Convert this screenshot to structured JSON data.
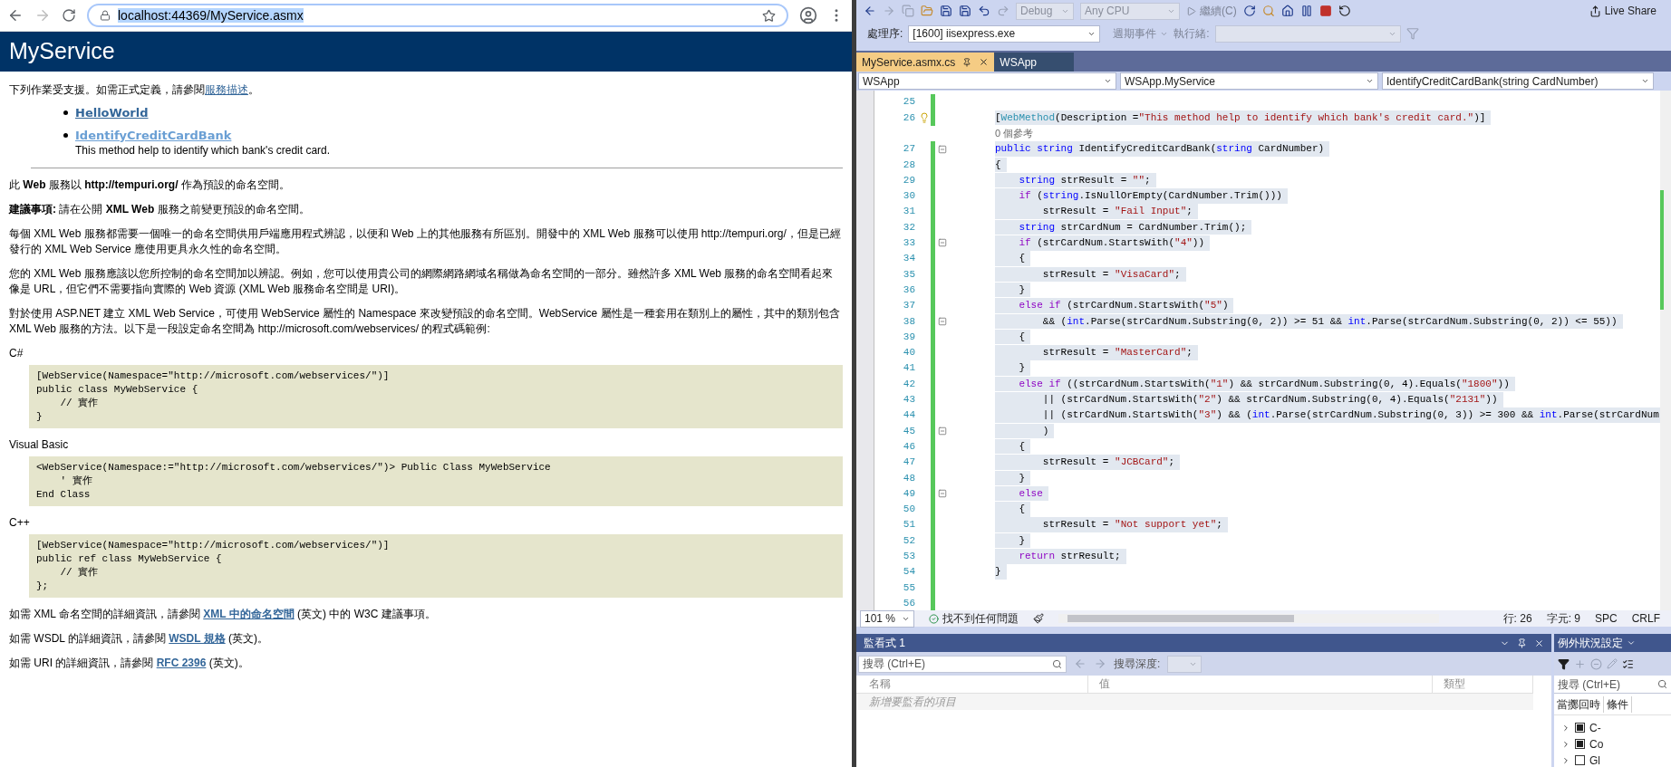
{
  "browser": {
    "url": "localhost:44369/MyService.asmx",
    "url_selected": true
  },
  "page": {
    "title": "MyService",
    "intro": {
      "before": "下列作業受支援。如需正式定義，請參閱",
      "link": "服務描述",
      "after": "。"
    },
    "operations": [
      {
        "name": "HelloWorld",
        "visited": false
      },
      {
        "name": "IdentifyCreditCardBank",
        "visited": true,
        "description": "This method help to identify which bank's credit card."
      }
    ],
    "notices": [
      "此 **Web** 服務以 **http://tempuri.org/** 作為預設的命名空間。",
      "**建議事項:** 請在公開 **XML Web** 服務之前變更預設的命名空間。"
    ],
    "paragraphs": [
      "每個 XML Web 服務都需要一個唯一的命名空間供用戶端應用程式辨認，以便和 Web 上的其他服務有所區別。開發中的 XML Web 服務可以使用 http://tempuri.org/，但是已經發行的 XML Web Service 應使用更具永久性的命名空間。",
      "您的 XML Web 服務應該以您所控制的命名空間加以辨認。例如，您可以使用貴公司的網際網路網域名稱做為命名空間的一部分。雖然許多 XML Web 服務的命名空間看起來像是 URL，但它們不需要指向實際的 Web 資源 (XML Web 服務命名空間是 URI)。",
      "對於使用 ASP.NET 建立 XML Web Service，可使用 WebService 屬性的 Namespace 來改變預設的命名空間。WebService 屬性是一種套用在類別上的屬性，其中的類別包含 XML Web 服務的方法。以下是一段設定命名空間為 http://microsoft.com/webservices/ 的程式碼範例:"
    ],
    "samples": [
      {
        "language": "C#",
        "code": "[WebService(Namespace=\"http://microsoft.com/webservices/\")]\npublic class MyWebService {\n    // 實作\n}"
      },
      {
        "language": "Visual Basic",
        "code": "<WebService(Namespace:=\"http://microsoft.com/webservices/\")> Public Class MyWebService\n    ' 實作\nEnd Class"
      },
      {
        "language": "C++",
        "code": "[WebService(Namespace=\"http://microsoft.com/webservices/\")]\npublic ref class MyWebService {\n    // 實作\n};"
      }
    ],
    "references": [
      {
        "before": "如需 XML 命名空間的詳細資訊，請參閱 ",
        "link": "XML 中的命名空間",
        "after": " (英文) 中的 W3C 建議事項。"
      },
      {
        "before": "如需 WSDL 的詳細資訊，請參閱 ",
        "link": "WSDL 規格",
        "after": " (英文)。"
      },
      {
        "before": "如需 URI 的詳細資訊，請參閱 ",
        "link": "RFC 2396",
        "after": " (英文)。"
      }
    ]
  },
  "vs": {
    "toolbar": {
      "configuration": {
        "label": "Debug",
        "disabled": true
      },
      "platform": {
        "label": "Any CPU",
        "disabled": true
      },
      "continue": "繼續(C)",
      "live_share": "Live Share"
    },
    "toolbar2": {
      "process_label": "處理序:",
      "process": "[1600] iisexpress.exe",
      "lifecycle": "週期事件",
      "thread_label": "執行緒:"
    },
    "tabs": [
      {
        "label": "MyService.asmx.cs",
        "selected": true
      },
      {
        "label": "WSApp",
        "selected": false
      }
    ],
    "nav": [
      "WSApp",
      "WSApp.MyService",
      "IdentifyCreditCardBank(string CardNumber)"
    ],
    "code": {
      "lines": [
        {
          "num": "25"
        },
        {
          "num": "26",
          "selected": true,
          "bulb": true,
          "tokens": [
            {
              "kind": "plain",
              "text": "["
            },
            {
              "kind": "type",
              "text": "WebMethod"
            },
            {
              "kind": "plain",
              "text": "(Description ="
            },
            {
              "kind": "string",
              "text": "\"This method help to identify which bank's credit card.\""
            },
            {
              "kind": "plain",
              "text": ")]"
            }
          ]
        },
        {
          "kind": "hint",
          "tokens": [
            {
              "kind": "hint",
              "text": "0 個參考"
            }
          ]
        },
        {
          "num": "27",
          "selected": true,
          "fold": true,
          "tokens": [
            {
              "kind": "keyword",
              "text": "public string"
            },
            {
              "kind": "plain",
              "text": " IdentifyCreditCardBank("
            },
            {
              "kind": "keyword",
              "text": "string"
            },
            {
              "kind": "plain",
              "text": " CardNumber)"
            }
          ]
        },
        {
          "num": "28",
          "selected": true,
          "tokens": [
            {
              "kind": "plain",
              "text": "{"
            }
          ]
        },
        {
          "num": "29",
          "selected": true,
          "tokens": [
            {
              "kind": "keyword",
              "text": "    string"
            },
            {
              "kind": "plain",
              "text": " strResult = "
            },
            {
              "kind": "string",
              "text": "\"\""
            },
            {
              "kind": "plain",
              "text": ";"
            }
          ]
        },
        {
          "num": "30",
          "selected": true,
          "tokens": [
            {
              "kind": "control",
              "text": "    if"
            },
            {
              "kind": "plain",
              "text": " ("
            },
            {
              "kind": "keyword",
              "text": "string"
            },
            {
              "kind": "plain",
              "text": ".IsNullOrEmpty(CardNumber.Trim()))"
            }
          ]
        },
        {
          "num": "31",
          "selected": true,
          "tokens": [
            {
              "kind": "plain",
              "text": "        strResult = "
            },
            {
              "kind": "string",
              "text": "\"Fail Input\""
            },
            {
              "kind": "plain",
              "text": ";"
            }
          ]
        },
        {
          "num": "32",
          "selected": true,
          "tokens": [
            {
              "kind": "keyword",
              "text": "    string"
            },
            {
              "kind": "plain",
              "text": " strCardNum = CardNumber.Trim();"
            }
          ]
        },
        {
          "num": "33",
          "selected": true,
          "fold": true,
          "tokens": [
            {
              "kind": "control",
              "text": "    if"
            },
            {
              "kind": "plain",
              "text": " (strCardNum.StartsWith("
            },
            {
              "kind": "string",
              "text": "\"4\""
            },
            {
              "kind": "plain",
              "text": "))"
            }
          ]
        },
        {
          "num": "34",
          "selected": true,
          "tokens": [
            {
              "kind": "plain",
              "text": "    {"
            }
          ]
        },
        {
          "num": "35",
          "selected": true,
          "tokens": [
            {
              "kind": "plain",
              "text": "        strResult = "
            },
            {
              "kind": "string",
              "text": "\"VisaCard\""
            },
            {
              "kind": "plain",
              "text": ";"
            }
          ]
        },
        {
          "num": "36",
          "selected": true,
          "tokens": [
            {
              "kind": "plain",
              "text": "    }"
            }
          ]
        },
        {
          "num": "37",
          "selected": true,
          "tokens": [
            {
              "kind": "control",
              "text": "    else if"
            },
            {
              "kind": "plain",
              "text": " (strCardNum.StartsWith("
            },
            {
              "kind": "string",
              "text": "\"5\""
            },
            {
              "kind": "plain",
              "text": ")"
            }
          ]
        },
        {
          "num": "38",
          "selected": true,
          "fold": true,
          "tokens": [
            {
              "kind": "plain",
              "text": "        && ("
            },
            {
              "kind": "keyword",
              "text": "int"
            },
            {
              "kind": "plain",
              "text": ".Parse(strCardNum.Substring(0, 2)) >= 51 && "
            },
            {
              "kind": "keyword",
              "text": "int"
            },
            {
              "kind": "plain",
              "text": ".Parse(strCardNum.Substring(0, 2)) <= 55))"
            }
          ]
        },
        {
          "num": "39",
          "selected": true,
          "tokens": [
            {
              "kind": "plain",
              "text": "    {"
            }
          ]
        },
        {
          "num": "40",
          "selected": true,
          "tokens": [
            {
              "kind": "plain",
              "text": "        strResult = "
            },
            {
              "kind": "string",
              "text": "\"MasterCard\""
            },
            {
              "kind": "plain",
              "text": ";"
            }
          ]
        },
        {
          "num": "41",
          "selected": true,
          "tokens": [
            {
              "kind": "plain",
              "text": "    }"
            }
          ]
        },
        {
          "num": "42",
          "selected": true,
          "tokens": [
            {
              "kind": "control",
              "text": "    else if"
            },
            {
              "kind": "plain",
              "text": " ((strCardNum.StartsWith("
            },
            {
              "kind": "string",
              "text": "\"1\""
            },
            {
              "kind": "plain",
              "text": ") && strCardNum.Substring(0, 4).Equals("
            },
            {
              "kind": "string",
              "text": "\"1800\""
            },
            {
              "kind": "plain",
              "text": "))"
            }
          ]
        },
        {
          "num": "43",
          "selected": true,
          "tokens": [
            {
              "kind": "plain",
              "text": "        || (strCardNum.StartsWith("
            },
            {
              "kind": "string",
              "text": "\"2\""
            },
            {
              "kind": "plain",
              "text": ") && strCardNum.Substring(0, 4).Equals("
            },
            {
              "kind": "string",
              "text": "\"2131\""
            },
            {
              "kind": "plain",
              "text": "))"
            }
          ]
        },
        {
          "num": "44",
          "selected": true,
          "tokens": [
            {
              "kind": "plain",
              "text": "        || (strCardNum.StartsWith("
            },
            {
              "kind": "string",
              "text": "\"3\""
            },
            {
              "kind": "plain",
              "text": ") && ("
            },
            {
              "kind": "keyword",
              "text": "int"
            },
            {
              "kind": "plain",
              "text": ".Parse(strCardNum.Substring(0, 3)) >= 300 && "
            },
            {
              "kind": "keyword",
              "text": "int"
            },
            {
              "kind": "plain",
              "text": ".Parse(strCardNum"
            }
          ]
        },
        {
          "num": "45",
          "selected": true,
          "fold": true,
          "tokens": [
            {
              "kind": "plain",
              "text": "        )"
            }
          ]
        },
        {
          "num": "46",
          "selected": true,
          "tokens": [
            {
              "kind": "plain",
              "text": "    {"
            }
          ]
        },
        {
          "num": "47",
          "selected": true,
          "tokens": [
            {
              "kind": "plain",
              "text": "        strResult = "
            },
            {
              "kind": "string",
              "text": "\"JCBCard\""
            },
            {
              "kind": "plain",
              "text": ";"
            }
          ]
        },
        {
          "num": "48",
          "selected": true,
          "tokens": [
            {
              "kind": "plain",
              "text": "    }"
            }
          ]
        },
        {
          "num": "49",
          "selected": true,
          "fold": true,
          "tokens": [
            {
              "kind": "control",
              "text": "    else"
            }
          ]
        },
        {
          "num": "50",
          "selected": true,
          "tokens": [
            {
              "kind": "plain",
              "text": "    {"
            }
          ]
        },
        {
          "num": "51",
          "selected": true,
          "tokens": [
            {
              "kind": "plain",
              "text": "        strResult = "
            },
            {
              "kind": "string",
              "text": "\"Not support yet\""
            },
            {
              "kind": "plain",
              "text": ";"
            }
          ]
        },
        {
          "num": "52",
          "selected": true,
          "tokens": [
            {
              "kind": "plain",
              "text": "    }"
            }
          ]
        },
        {
          "num": "53",
          "selected": true,
          "tokens": [
            {
              "kind": "control",
              "text": "    return"
            },
            {
              "kind": "plain",
              "text": " strResult;"
            }
          ]
        },
        {
          "num": "54",
          "selected": true,
          "tokens": [
            {
              "kind": "plain",
              "text": "}"
            }
          ]
        },
        {
          "num": "55"
        },
        {
          "num": "56"
        }
      ]
    },
    "status": {
      "zoom": "101 %",
      "issues": "找不到任何問題",
      "line": "行: 26",
      "column": "字元: 9",
      "spacing": "SPC",
      "line_ending": "CRLF"
    },
    "watch": {
      "title": "監看式 1",
      "search_placeholder": "搜尋 (Ctrl+E)",
      "depth_label": "搜尋深度:",
      "columns": [
        "名稱",
        "值",
        "類型"
      ],
      "add_row": "新增要監看的項目"
    },
    "exceptions": {
      "title": "例外狀況設定",
      "search_placeholder": "搜尋 (Ctrl+E)",
      "columns": [
        "當擲回時",
        "條件"
      ],
      "rows": [
        {
          "label": "C-",
          "checked": true
        },
        {
          "label": "Co",
          "checked": true
        },
        {
          "label": "Gl",
          "checked": false
        }
      ]
    }
  }
}
